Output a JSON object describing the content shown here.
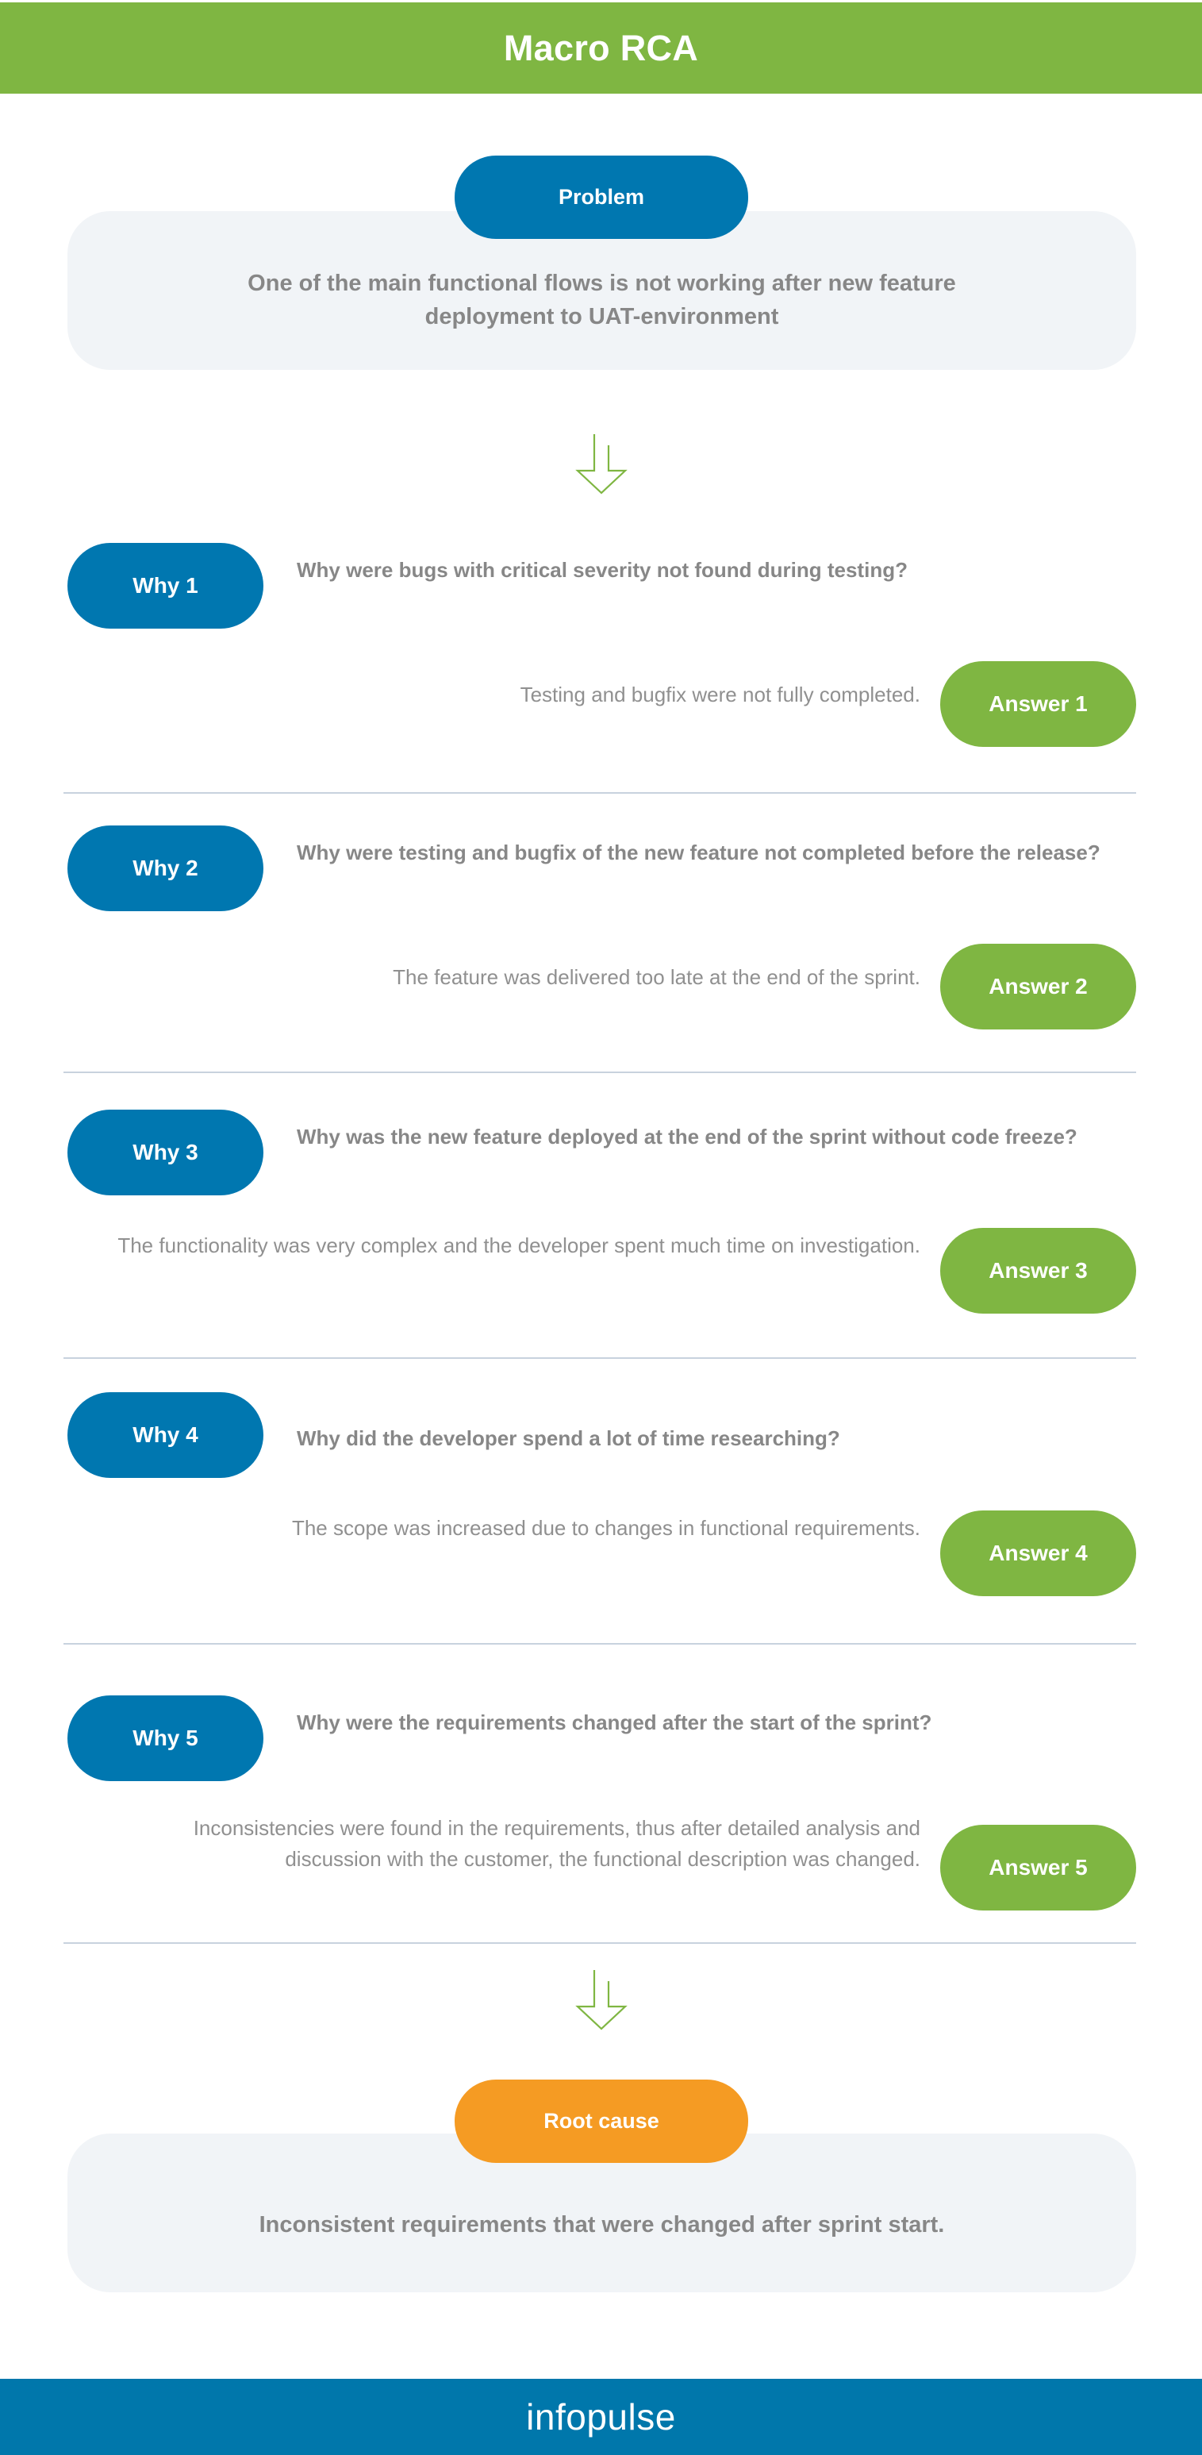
{
  "header": {
    "title": "Macro RCA",
    "background_color": "#7FB642"
  },
  "problem": {
    "pill_label": "Problem",
    "pill_color": "#0077B0",
    "text": "One of the main functional flows is not working after new feature deployment to UAT-environment",
    "panel_color": "#F1F4F7"
  },
  "arrow": {
    "icon": "arrow-down-icon",
    "color": "#7FB642"
  },
  "why_steps": [
    {
      "why_label": "Why 1",
      "question": "Why were bugs with critical severity not found during testing?",
      "answer_label": "Answer 1",
      "answer": "Testing and bugfix were not fully completed."
    },
    {
      "why_label": "Why 2",
      "question": "Why were testing and bugfix of the new feature not completed before the release?",
      "answer_label": "Answer 2",
      "answer": "The feature was delivered too late at the end of the sprint."
    },
    {
      "why_label": "Why 3",
      "question": "Why was the new feature deployed at the end of the sprint without code freeze?",
      "answer_label": "Answer 3",
      "answer": "The functionality was very complex and the developer spent much time on investigation."
    },
    {
      "why_label": "Why 4",
      "question": "Why did the developer spend a lot of time researching?",
      "answer_label": "Answer 4",
      "answer": "The scope was increased due to changes in functional requirements."
    },
    {
      "why_label": "Why 5",
      "question": "Why were the requirements changed after the start of the sprint?",
      "answer_label": "Answer 5",
      "answer": "Inconsistencies were found in the requirements, thus after detailed analysis and discussion with the customer, the functional description was changed."
    }
  ],
  "root_cause": {
    "pill_label": "Root cause",
    "pill_color": "#F59B23",
    "text": "Inconsistent requirements that were changed after sprint start."
  },
  "footer": {
    "logo_text": "infopulse",
    "background_color": "#0077AB"
  },
  "colors": {
    "green": "#7FB642",
    "blue": "#0077B0",
    "orange": "#F59B23",
    "panel": "#F1F4F7",
    "question_text": "#878787",
    "answer_text": "#909090",
    "divider": "#C8D2DE"
  }
}
